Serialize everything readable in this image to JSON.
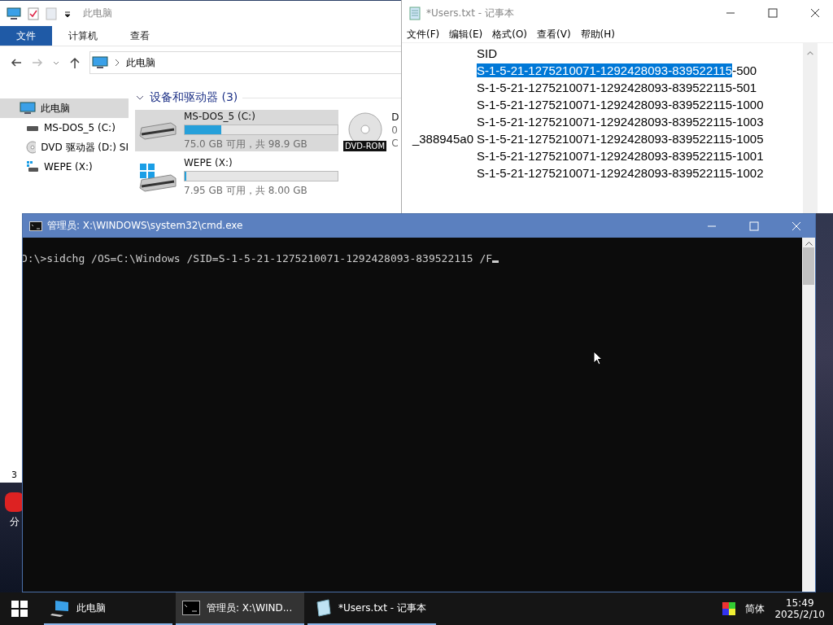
{
  "explorer": {
    "title": "此电脑",
    "ribbon_tabs": [
      {
        "label": "文件",
        "selected": true
      },
      {
        "label": "计算机",
        "selected": false
      },
      {
        "label": "查看",
        "selected": false
      }
    ],
    "address": "此电脑",
    "sidebar": [
      {
        "label": "此电脑",
        "kind": "pc",
        "selected": true
      },
      {
        "label": "MS-DOS_5 (C:)",
        "kind": "disk",
        "selected": false
      },
      {
        "label": "DVD 驱动器 (D:) SI",
        "kind": "dvd",
        "selected": false
      },
      {
        "label": "WEPE (X:)",
        "kind": "win",
        "selected": false
      }
    ],
    "group": {
      "title": "设备和驱动器 (3)",
      "expanded": true
    },
    "drives": [
      {
        "name": "MS-DOS_5 (C:)",
        "kind": "disk",
        "selected": true,
        "level": 0.24,
        "free": "75.0 GB 可用，共 98.9 GB"
      },
      {
        "name": "WEPE (X:)",
        "kind": "win",
        "selected": false,
        "level": 0.01,
        "free": "7.95 GB 可用，共 8.00 GB"
      }
    ],
    "dvd": {
      "name": "D",
      "badge": "DVD-ROM",
      "line_2": "0",
      "line_3": "C"
    },
    "status": "3"
  },
  "desktop_icon": {
    "label": "分"
  },
  "notepad": {
    "title": "*Users.txt - 记事本",
    "menu": [
      "文件(F)",
      "编辑(E)",
      "格式(O)",
      "查看(V)",
      "帮助(H)"
    ],
    "lines": [
      {
        "text": "SID"
      },
      {
        "highlight": "S-1-5-21-1275210071-1292428093-839522115",
        "text": "-500"
      },
      {
        "text": "S-1-5-21-1275210071-1292428093-839522115-501"
      },
      {
        "text": "S-1-5-21-1275210071-1292428093-839522115-1000"
      },
      {
        "text": "S-1-5-21-1275210071-1292428093-839522115-1003"
      },
      {
        "left": "_388945a0",
        "text": "S-1-5-21-1275210071-1292428093-839522115-1005"
      },
      {
        "text": "S-1-5-21-1275210071-1292428093-839522115-1001"
      },
      {
        "text": "S-1-5-21-1275210071-1292428093-839522115-1002"
      }
    ]
  },
  "cmd": {
    "title": "管理员: X:\\WINDOWS\\system32\\cmd.exe",
    "lines": [
      "D:\\>sidchg /OS=C:\\Windows /SID=S-1-5-21-1275210071-1292428093-839522115 /F"
    ]
  },
  "taskbar": {
    "items": [
      {
        "label": "此电脑",
        "kind": "pc",
        "selected": false
      },
      {
        "label": "管理员: X:\\WIND...",
        "kind": "cmd",
        "selected": true
      },
      {
        "label": "*Users.txt - 记事本",
        "kind": "notepad",
        "selected": false
      }
    ],
    "ime": "简体",
    "time": "15:49",
    "date": "2025/2/10"
  }
}
